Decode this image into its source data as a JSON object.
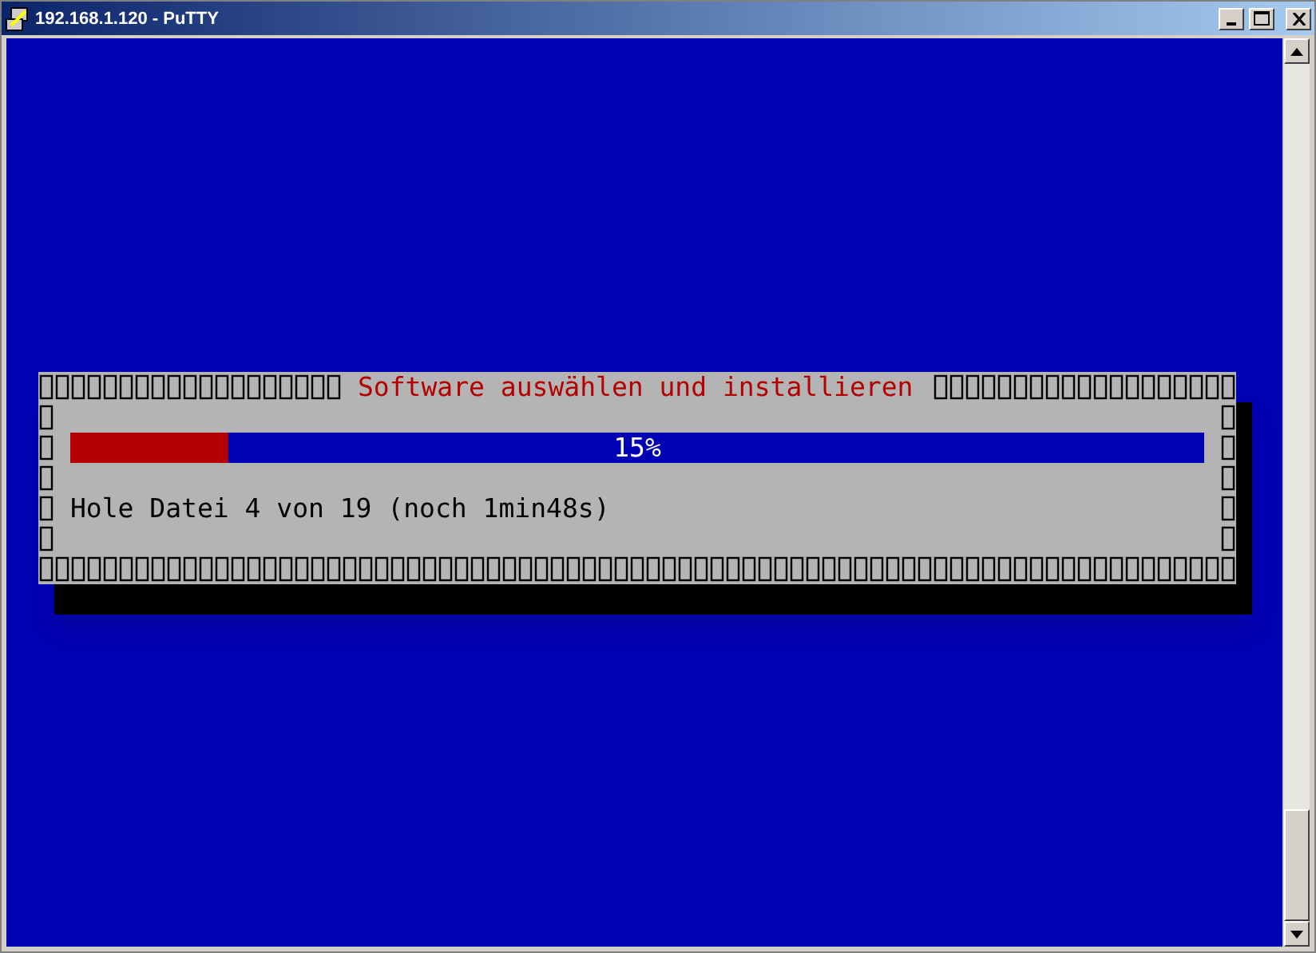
{
  "window": {
    "title": "192.168.1.120 - PuTTY"
  },
  "dialog": {
    "title": "Software auswählen und installieren",
    "progress": {
      "level": 0.14,
      "reading": "15%"
    },
    "message": "Hole Datei 4 von 19 (noch 1min48s)"
  }
}
